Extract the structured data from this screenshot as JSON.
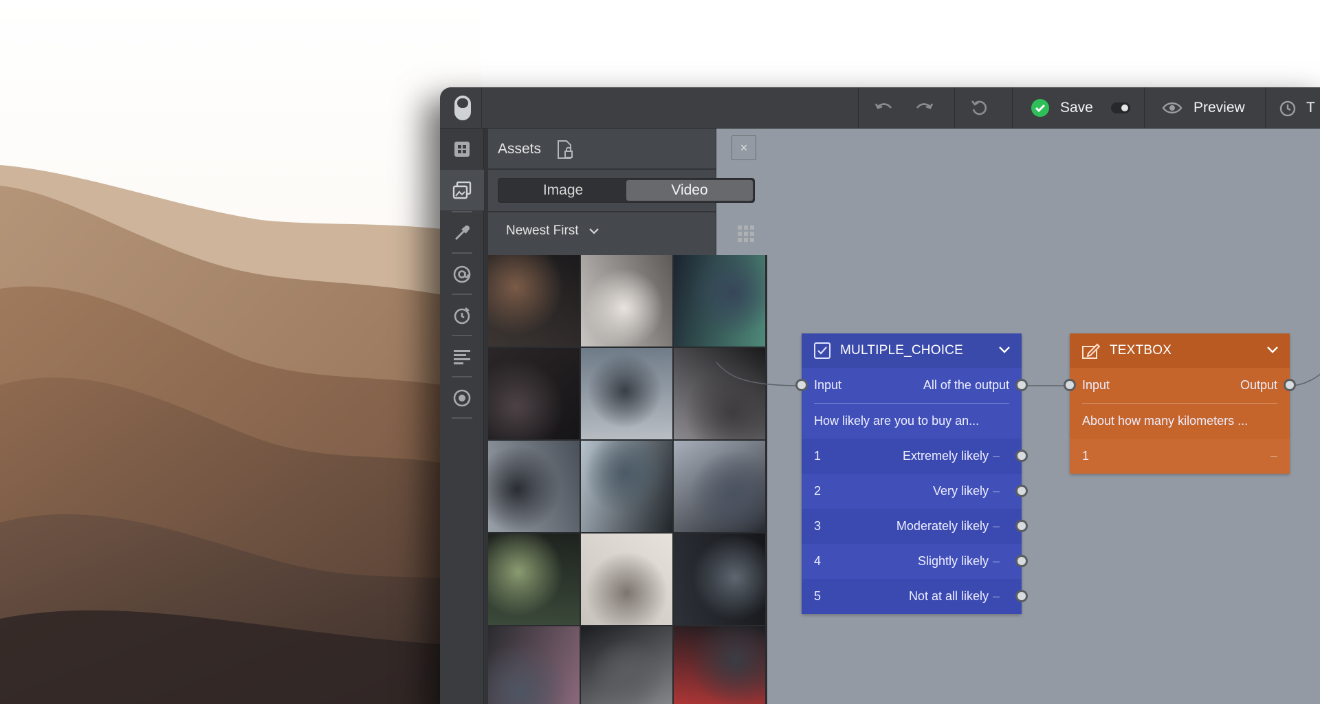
{
  "toolbar": {
    "save_label": "Save",
    "preview_label": "Preview",
    "truncated_label": "T",
    "accent_color": "#2fbf59"
  },
  "assets": {
    "title": "Assets",
    "close_label": "×",
    "tabs": [
      "Image",
      "Video"
    ],
    "active_tab": "Video",
    "sort_label": "Newest First"
  },
  "rail_icons": [
    "grid-icon",
    "gallery-icon",
    "eyedropper-icon",
    "at-sign-icon",
    "timer-icon",
    "text-align-icon",
    "record-icon"
  ],
  "nodes": {
    "multiple_choice": {
      "title": "MULTIPLE_CHOICE",
      "input_label": "Input",
      "output_label": "All of the output",
      "question": "How likely are you to buy an...",
      "options": [
        {
          "num": "1",
          "label": "Extremely likely"
        },
        {
          "num": "2",
          "label": "Very likely"
        },
        {
          "num": "3",
          "label": "Moderately likely"
        },
        {
          "num": "4",
          "label": "Slightly likely"
        },
        {
          "num": "5",
          "label": "Not at all likely"
        }
      ],
      "color": "#3f4db3"
    },
    "textbox": {
      "title": "TEXTBOX",
      "input_label": "Input",
      "output_label": "Output",
      "question": "About how many kilometers ...",
      "row_num": "1",
      "color": "#c3622a"
    }
  }
}
